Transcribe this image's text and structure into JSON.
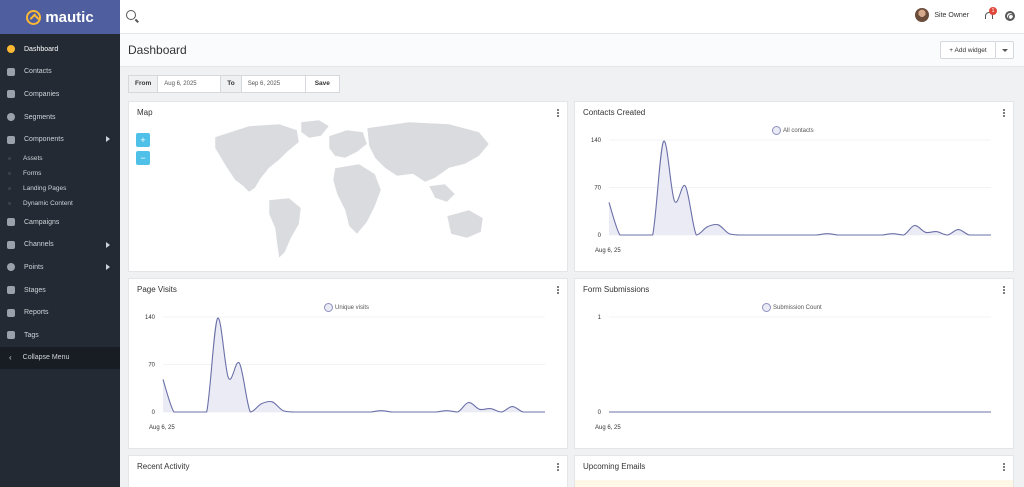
{
  "brand": {
    "name": "mautic",
    "accent": "#fdb933",
    "bar_color": "#4e5e9e"
  },
  "sidebar": {
    "items": [
      {
        "label": "Dashboard",
        "icon": "dashboard-icon",
        "active": true
      },
      {
        "label": "Contacts",
        "icon": "user-icon"
      },
      {
        "label": "Companies",
        "icon": "building-icon"
      },
      {
        "label": "Segments",
        "icon": "pie-icon"
      },
      {
        "label": "Components",
        "icon": "puzzle-icon",
        "has_children": true
      }
    ],
    "sub_items": [
      "Assets",
      "Forms",
      "Landing Pages",
      "Dynamic Content"
    ],
    "items_after": [
      {
        "label": "Campaigns",
        "icon": "megaphone-icon"
      },
      {
        "label": "Channels",
        "icon": "rss-icon",
        "has_children": true
      },
      {
        "label": "Points",
        "icon": "target-icon",
        "has_children": true
      },
      {
        "label": "Stages",
        "icon": "filter-icon"
      },
      {
        "label": "Reports",
        "icon": "report-icon"
      },
      {
        "label": "Tags",
        "icon": "hash-icon"
      }
    ],
    "collapse_label": "Collapse Menu"
  },
  "header": {
    "user_name": "Site Owner",
    "notification_count": "1"
  },
  "page": {
    "title": "Dashboard",
    "add_widget_label": "+ Add widget"
  },
  "filter": {
    "from_label": "From",
    "from_value": "Aug 6, 2025",
    "to_label": "To",
    "to_value": "Sep 6, 2025",
    "save_label": "Save"
  },
  "widgets": {
    "map": {
      "title": "Map",
      "zoom_in": "+",
      "zoom_out": "−"
    },
    "contacts_created": {
      "title": "Contacts Created"
    },
    "page_visits": {
      "title": "Page Visits"
    },
    "form_submissions": {
      "title": "Form Submissions"
    },
    "recent_activity": {
      "title": "Recent Activity"
    },
    "upcoming_emails": {
      "title": "Upcoming Emails"
    }
  },
  "chart_data": [
    {
      "type": "area",
      "title": "Contacts Created",
      "legend": [
        "All contacts"
      ],
      "ylim": [
        0,
        140
      ],
      "yticks": [
        0,
        70,
        140
      ],
      "x_start_label": "Aug 6, 25",
      "series": [
        {
          "name": "All contacts",
          "values": [
            48,
            0,
            0,
            0,
            0,
            138,
            50,
            72,
            0,
            12,
            15,
            2,
            0,
            0,
            0,
            0,
            0,
            0,
            0,
            0,
            2,
            0,
            0,
            0,
            0,
            0,
            2,
            0,
            14,
            4,
            5,
            0,
            8,
            0,
            0,
            0
          ]
        }
      ]
    },
    {
      "type": "area",
      "title": "Page Visits",
      "legend": [
        "Unique visits"
      ],
      "ylim": [
        0,
        140
      ],
      "yticks": [
        0,
        70,
        140
      ],
      "x_start_label": "Aug 6, 25",
      "series": [
        {
          "name": "Unique visits",
          "values": [
            48,
            0,
            0,
            0,
            0,
            138,
            50,
            72,
            0,
            12,
            15,
            2,
            0,
            0,
            0,
            0,
            0,
            0,
            0,
            0,
            2,
            0,
            0,
            0,
            0,
            0,
            2,
            0,
            14,
            4,
            5,
            0,
            8,
            0,
            0,
            0
          ]
        }
      ]
    },
    {
      "type": "line",
      "title": "Form Submissions",
      "legend": [
        "Submission Count"
      ],
      "ylim": [
        0,
        1
      ],
      "yticks": [
        0,
        1
      ],
      "x_start_label": "Aug 6, 25",
      "series": [
        {
          "name": "Submission Count",
          "values": [
            0,
            0,
            0,
            0,
            0,
            0,
            0,
            0,
            0,
            0,
            0,
            0,
            0,
            0,
            0,
            0,
            0,
            0,
            0,
            0,
            0,
            0,
            0,
            0,
            0,
            0,
            0,
            0,
            0,
            0,
            0,
            0,
            0,
            0,
            0,
            0
          ]
        }
      ]
    }
  ]
}
